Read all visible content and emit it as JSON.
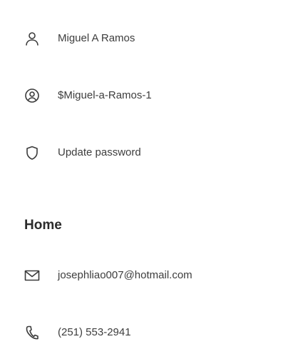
{
  "profile": {
    "name": "Miguel A Ramos",
    "handle": "$Miguel-a-Ramos-1",
    "password_action": "Update password"
  },
  "home": {
    "heading": "Home",
    "email": "josephliao007@hotmail.com",
    "phone": "(251) 553-2941"
  },
  "icons": {
    "name": "person-icon",
    "handle": "user-circle-icon",
    "password": "shield-icon",
    "email": "mail-icon",
    "phone": "phone-icon"
  },
  "colors": {
    "text": "#3d3d3d",
    "heading": "#2b2b2b",
    "icon": "#3b3b3b",
    "background": "#ffffff"
  }
}
